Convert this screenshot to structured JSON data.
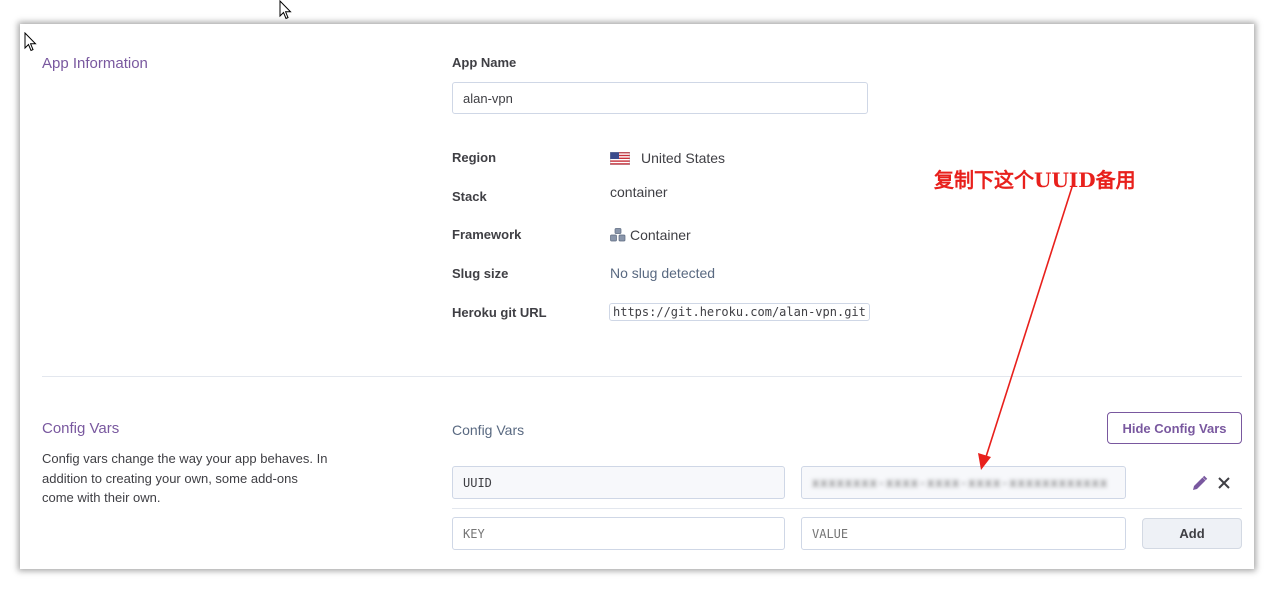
{
  "app_info": {
    "section_title": "App Information",
    "app_name_label": "App Name",
    "app_name_value": "alan-vpn",
    "region_label": "Region",
    "region_value": "United States",
    "stack_label": "Stack",
    "stack_value": "container",
    "framework_label": "Framework",
    "framework_value": "Container",
    "slug_label": "Slug size",
    "slug_value": "No slug detected",
    "git_label": "Heroku git URL",
    "git_value": "https://git.heroku.com/alan-vpn.git"
  },
  "config_vars": {
    "section_title": "Config Vars",
    "description": "Config vars change the way your app behaves. In addition to creating your own, some add-ons come with their own.",
    "subheader": "Config Vars",
    "hide_button": "Hide Config Vars",
    "rows": [
      {
        "key": "UUID",
        "value": "xxxxxxxx-xxxx-xxxx-xxxx-xxxxxxxxxxxx"
      }
    ],
    "new_key_placeholder": "KEY",
    "new_value_placeholder": "VALUE",
    "add_button": "Add"
  },
  "annotation": {
    "text": "复制下这个UUID备用",
    "color": "#e8201c"
  },
  "colors": {
    "accent": "#79589f",
    "border": "#cfd7e6",
    "text": "#3f3f44"
  },
  "icons": [
    "cursor-arrow-icon",
    "us-flag-icon",
    "container-framework-icon",
    "pencil-icon",
    "close-icon"
  ]
}
